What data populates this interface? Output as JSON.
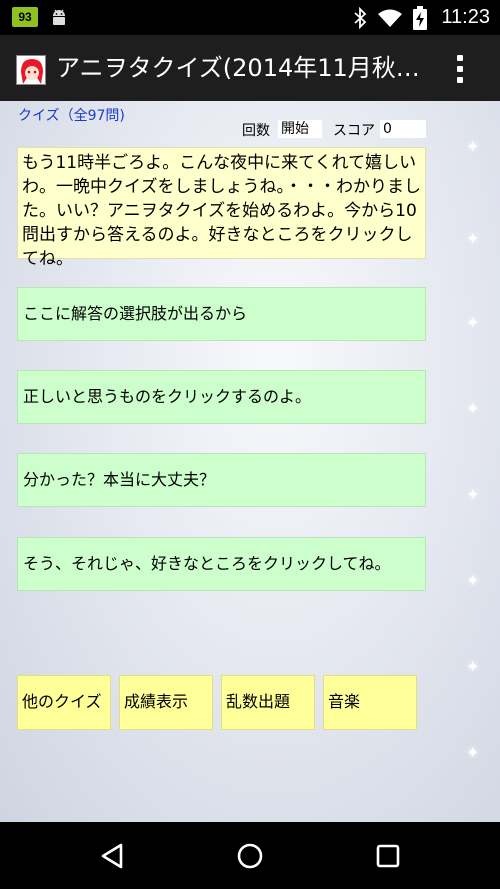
{
  "status_bar": {
    "battery_level": "93",
    "clock": "11:23",
    "icons": [
      "android-debug-icon",
      "bluetooth-icon",
      "wifi-icon",
      "battery-charging-icon"
    ]
  },
  "action_bar": {
    "title": "アニヲタクイズ(2014年11月秋…",
    "overflow_icon": "overflow-menu-icon"
  },
  "quiz": {
    "count_label": "クイズ（全97問)",
    "round_label": "回数",
    "round_value": "開始",
    "score_label": "スコア",
    "score_value": "0"
  },
  "message": "もう11時半ごろよ。こんな夜中に来てくれて嬉しいわ。一晩中クイズをしましょうね。・・・わかりました。いい？アニヲタクイズを始めるわよ。今から10問出すから答えるのよ。好きなところをクリックしてね。",
  "answers": [
    "ここに解答の選択肢が出るから",
    "正しいと思うものをクリックするのよ。",
    "分かった？本当に大丈夫？",
    "そう、それじゃ、好きなところをクリックしてね。"
  ],
  "menu": {
    "other_quiz": "他のクイズ",
    "results": "成績表示",
    "random": "乱数出題",
    "music": "音楽"
  },
  "colors": {
    "message_bg": "#ffffcc",
    "answer_bg": "#ccffcc",
    "menu_bg": "#ffff99",
    "quiz_count_color": "#1a3cc9",
    "battery_badge": "#8fc21f"
  }
}
